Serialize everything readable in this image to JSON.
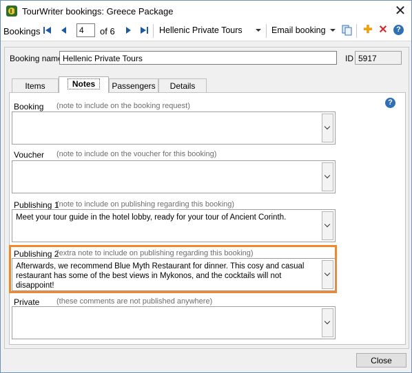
{
  "window": {
    "title": "TourWriter bookings: Greece Package",
    "close_glyph": "✕"
  },
  "toolbar": {
    "bookings_label": "Bookings",
    "record_value": "4",
    "record_of": "of 6",
    "booking_select": "Hellenic Private Tours",
    "email_select": "Email booking",
    "icons": [
      "first-record-icon",
      "prev-record-icon",
      "next-record-icon",
      "last-record-icon",
      "copy-icon",
      "add-icon",
      "delete-icon",
      "help-icon"
    ],
    "add_glyph": "✚",
    "delete_glyph": "✕",
    "help_glyph": "?"
  },
  "form": {
    "booking_name_label": "Booking name",
    "booking_name_value": "Hellenic Private Tours",
    "id_label": "ID",
    "id_value": "5917"
  },
  "tabs": [
    {
      "label": "Items",
      "active": false
    },
    {
      "label": "Notes",
      "active": true
    },
    {
      "label": "Passengers",
      "active": false
    },
    {
      "label": "Details",
      "active": false
    }
  ],
  "notes_help_glyph": "?",
  "notes": [
    {
      "label": "Booking",
      "hint": "(note to include on the booking request)",
      "text": ""
    },
    {
      "label": "Voucher",
      "hint": "(note to include on the voucher for this booking)",
      "text": ""
    },
    {
      "label": "Publishing 1",
      "hint": "(note to include on publishing regarding this booking)",
      "text": "Meet your tour guide in the hotel lobby, ready for your tour of Ancient Corinth."
    },
    {
      "label": "Publishing 2",
      "hint": "(extra note to include on publishing regarding this booking)",
      "text": "Afterwards, we recommend Blue Myth Restaurant for dinner. This cosy and casual restaurant has some of the best views in Mykonos, and the cocktails will not disappoint!"
    },
    {
      "label": "Private",
      "hint": "(these comments are not published anywhere)",
      "text": ""
    }
  ],
  "footer": {
    "close_label": "Close"
  },
  "colors": {
    "highlight": "#f0892e",
    "nav_arrows": "#1c5aa6",
    "add_icon": "#e8a317",
    "delete_icon": "#d22b2b"
  }
}
